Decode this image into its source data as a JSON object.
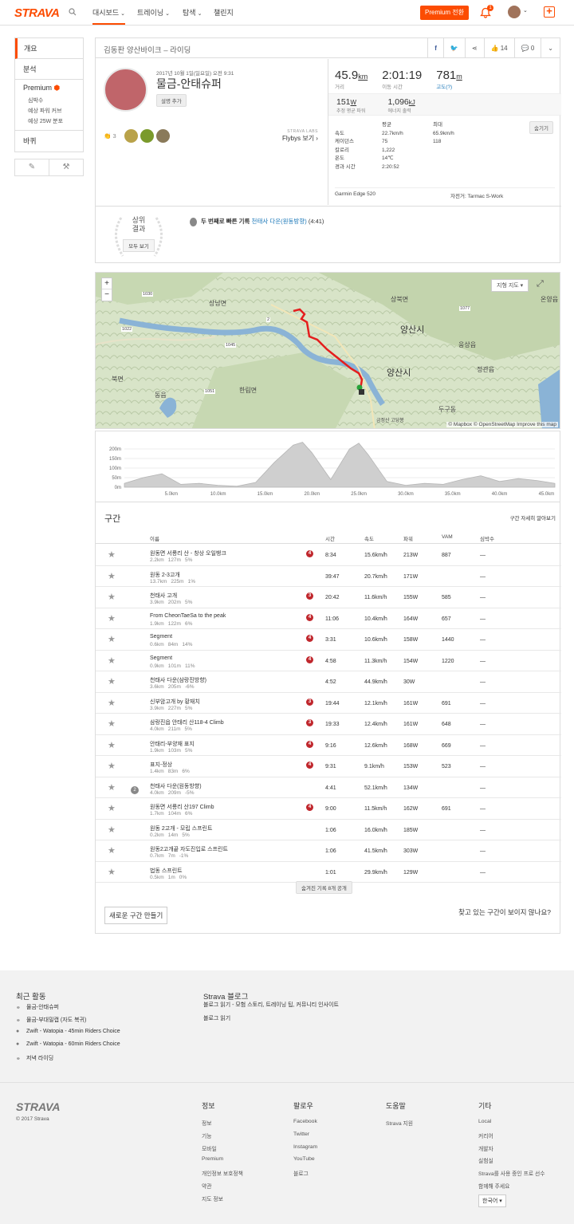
{
  "nav": {
    "logo": "STRAVA",
    "items": [
      {
        "label": "대시보드",
        "active": true
      },
      {
        "label": "트레이닝"
      },
      {
        "label": "탐색"
      },
      {
        "label": "챌린지"
      }
    ],
    "premium_button": "Premium 전환",
    "notification_count": "1",
    "accent": "#fc4c02"
  },
  "sidebar": {
    "overview": "개요",
    "analysis": "분석",
    "premium": "Premium",
    "sub": [
      "심박수",
      "예상 파워 커브",
      "예상 25W 분포"
    ],
    "bike": "바퀴"
  },
  "activity": {
    "header_title": "김동판 양산바이크 – 라이딩",
    "likes": "14",
    "comments": "0",
    "date": "2017년 10월 1일(일요일) 오전 9:31",
    "name": "물금-안태슈퍼",
    "add_description": "설명 추가",
    "kudos_count": "3",
    "flyby_lab": "STRAVA LABS",
    "flyby_text": "Flybys 보기 ›",
    "distance": "45.9",
    "distance_unit": "km",
    "distance_label": "거리",
    "moving_time": "2:01:19",
    "moving_time_label": "이동 시간",
    "elevation": "781",
    "elevation_unit": "m",
    "elevation_label": "고도(?)",
    "power": "151",
    "power_unit": "W",
    "power_label": "추정 평균 파워",
    "energy": "1,096",
    "energy_unit": "kJ",
    "energy_label": "에너지 출력",
    "table_head": [
      "",
      "평균",
      "최대"
    ],
    "table_rows": [
      [
        "속도",
        "22.7km/h",
        "65.9km/h"
      ],
      [
        "케이던스",
        "75",
        "118"
      ],
      [
        "칼로리",
        "1,222",
        ""
      ],
      [
        "온도",
        "14℃",
        ""
      ],
      [
        "경과 시간",
        "2:20:52",
        ""
      ]
    ],
    "hide_label": "숨기기",
    "device": "Garmin Edge 520",
    "bike": "자전거: Tarmac S-Work"
  },
  "top_results": {
    "title_1": "상위",
    "title_2": "결과",
    "view_all": "모두 보기",
    "rank_text": "두 번째로 빠른 기록",
    "segment_link": "천태사 다운(원동방향)",
    "time": "(4:41)"
  },
  "map": {
    "map_type": "지형 지도 ▾",
    "attribution": "© Mapbox © OpenStreetMap Improve this map",
    "labels": [
      "상북면",
      "온양읍",
      "양산시",
      "양산시",
      "상남면",
      "웅상읍",
      "북면",
      "동읍",
      "한림면",
      "두구동",
      "금정산 고당봉",
      "정관읍",
      "1022",
      "1030",
      "1045",
      "1051",
      "1077",
      "2"
    ]
  },
  "chart_data": {
    "type": "area",
    "x": [
      0,
      2,
      4,
      6,
      8,
      10,
      12,
      14,
      16,
      18,
      19,
      20,
      22,
      24,
      25,
      26,
      28,
      30,
      32,
      34,
      36,
      38,
      40,
      42,
      44,
      45.9
    ],
    "y": [
      20,
      50,
      70,
      15,
      20,
      10,
      5,
      25,
      130,
      220,
      235,
      180,
      40,
      200,
      230,
      170,
      30,
      10,
      20,
      15,
      40,
      60,
      30,
      45,
      35,
      20
    ],
    "x_ticks": [
      "5.0km",
      "10.0km",
      "15.0km",
      "20.0km",
      "25.0km",
      "30.0km",
      "35.0km",
      "40.0km",
      "45.0km"
    ],
    "y_ticks": [
      "200m",
      "150m",
      "100m",
      "50m",
      "0m"
    ],
    "xlim": [
      0,
      45.9
    ],
    "ylim": [
      0,
      240
    ]
  },
  "segments": {
    "title": "구간",
    "detail_link": "구간 자세히 알아보기",
    "headers": [
      "이름",
      "시간",
      "속도",
      "파워",
      "VAM",
      "심박수"
    ],
    "rows": [
      {
        "name": "원동면 서룡리 산 - 창상 오일뱅크",
        "dist": "2.2km",
        "elev": "127m",
        "grade": "5%",
        "cat": "4",
        "time": "8:34",
        "speed": "15.6km/h",
        "power": "213W",
        "vam": "887",
        "hr": "—"
      },
      {
        "name": "원동 2-3고개",
        "dist": "13.7km",
        "elev": "225m",
        "grade": "1%",
        "cat": "",
        "time": "39:47",
        "speed": "20.7km/h",
        "power": "171W",
        "vam": "",
        "hr": "—"
      },
      {
        "name": "천태사 고개",
        "dist": "3.9km",
        "elev": "202m",
        "grade": "5%",
        "cat": "3",
        "time": "20:42",
        "speed": "11.6km/h",
        "power": "155W",
        "vam": "585",
        "hr": "—"
      },
      {
        "name": "From CheonTaeSa to the peak",
        "dist": "1.9km",
        "elev": "122m",
        "grade": "6%",
        "cat": "4",
        "time": "11:06",
        "speed": "10.4km/h",
        "power": "164W",
        "vam": "657",
        "hr": "—"
      },
      {
        "name": "Segment",
        "dist": "0.6km",
        "elev": "84m",
        "grade": "14%",
        "cat": "4",
        "time": "3:31",
        "speed": "10.6km/h",
        "power": "158W",
        "vam": "1440",
        "hr": "—"
      },
      {
        "name": "Segment",
        "dist": "0.9km",
        "elev": "101m",
        "grade": "11%",
        "cat": "4",
        "time": "4:58",
        "speed": "11.3km/h",
        "power": "154W",
        "vam": "1220",
        "hr": "—"
      },
      {
        "name": "천태사 다운(삼랑진방향)",
        "dist": "3.6km",
        "elev": "205m",
        "grade": "-6%",
        "cat": "",
        "time": "4:52",
        "speed": "44.9km/h",
        "power": "30W",
        "vam": "",
        "hr": "—"
      },
      {
        "name": "신부암고개 by 황재치",
        "dist": "3.9km",
        "elev": "227m",
        "grade": "5%",
        "cat": "3",
        "time": "19:44",
        "speed": "12.1km/h",
        "power": "161W",
        "vam": "691",
        "hr": "—"
      },
      {
        "name": "삼랑진읍 안태리 산118-4 Climb",
        "dist": "4.0km",
        "elev": "211m",
        "grade": "5%",
        "cat": "3",
        "time": "19:33",
        "speed": "12.4km/h",
        "power": "161W",
        "vam": "648",
        "hr": "—"
      },
      {
        "name": "안태리-부양재 표지",
        "dist": "1.9km",
        "elev": "103m",
        "grade": "5%",
        "cat": "4",
        "time": "9:16",
        "speed": "12.6km/h",
        "power": "168W",
        "vam": "669",
        "hr": "—"
      },
      {
        "name": "표지-정상",
        "dist": "1.4km",
        "elev": "83m",
        "grade": "6%",
        "cat": "4",
        "time": "9:31",
        "speed": "9.1km/h",
        "power": "153W",
        "vam": "523",
        "hr": "—"
      },
      {
        "name": "천태사 다운(원동방향)",
        "dist": "4.0km",
        "elev": "209m",
        "grade": "-5%",
        "cat": "",
        "kom": "2",
        "time": "4:41",
        "speed": "52.1km/h",
        "power": "134W",
        "vam": "",
        "hr": "—"
      },
      {
        "name": "원동면 서룡리 산197 Climb",
        "dist": "1.7km",
        "elev": "104m",
        "grade": "6%",
        "cat": "4",
        "time": "9:00",
        "speed": "11.5km/h",
        "power": "162W",
        "vam": "691",
        "hr": "—"
      },
      {
        "name": "원동 2고개 - 모립 스프린트",
        "dist": "0.2km",
        "elev": "14m",
        "grade": "5%",
        "cat": "",
        "time": "1:06",
        "speed": "16.0km/h",
        "power": "185W",
        "vam": "",
        "hr": "—"
      },
      {
        "name": "원동2고개끝 자도진입로 스프린트",
        "dist": "0.7km",
        "elev": "7m",
        "grade": "-1%",
        "cat": "",
        "time": "1:06",
        "speed": "41.5km/h",
        "power": "303W",
        "vam": "",
        "hr": "—"
      },
      {
        "name": "법동 스프린트",
        "dist": "0.5km",
        "elev": "1m",
        "grade": "0%",
        "cat": "",
        "time": "1:01",
        "speed": "29.9km/h",
        "power": "129W",
        "vam": "",
        "hr": "—"
      }
    ],
    "hidden_button": "숨겨진 기록 8개 공개",
    "new_segment": "새로운 구간 만들기",
    "not_shown": "찾고 있는 구간이 보이지 않나요?"
  },
  "recent": {
    "title": "최근 활동",
    "items": [
      "물금-안태슈퍼",
      "물금-부대밀캡 (자도 복귀)",
      "Zwift - Watopia - 45min Riders Choice",
      "Zwift - Watopia - 60min Riders Choice",
      "저녁 라이딩"
    ],
    "blog_title": "Strava 블로그",
    "blog_line": "블로그 읽기 - 모험 스토리, 트레이닝 팁, 커뮤니티 인사이트",
    "blog_read": "블로그 읽기"
  },
  "footer": {
    "logo": "STRAVA",
    "copyright": "© 2017 Strava",
    "cols": [
      {
        "head": "정보",
        "items": [
          "정보",
          "기능",
          "모바일",
          "Premium",
          "개인정보 보호정책",
          "약관",
          "지도 정보"
        ]
      },
      {
        "head": "팔로우",
        "items": [
          "Facebook",
          "Twitter",
          "Instagram",
          "YouTube",
          "블로그"
        ]
      },
      {
        "head": "도움말",
        "items": [
          "Strava 지원"
        ]
      },
      {
        "head": "기타",
        "items": [
          "Local",
          "커리어",
          "개발자",
          "실험실",
          "Strava를 사용 중인 프로 선수",
          "함께해 주세요"
        ]
      }
    ],
    "language": "한국어 ▾"
  }
}
